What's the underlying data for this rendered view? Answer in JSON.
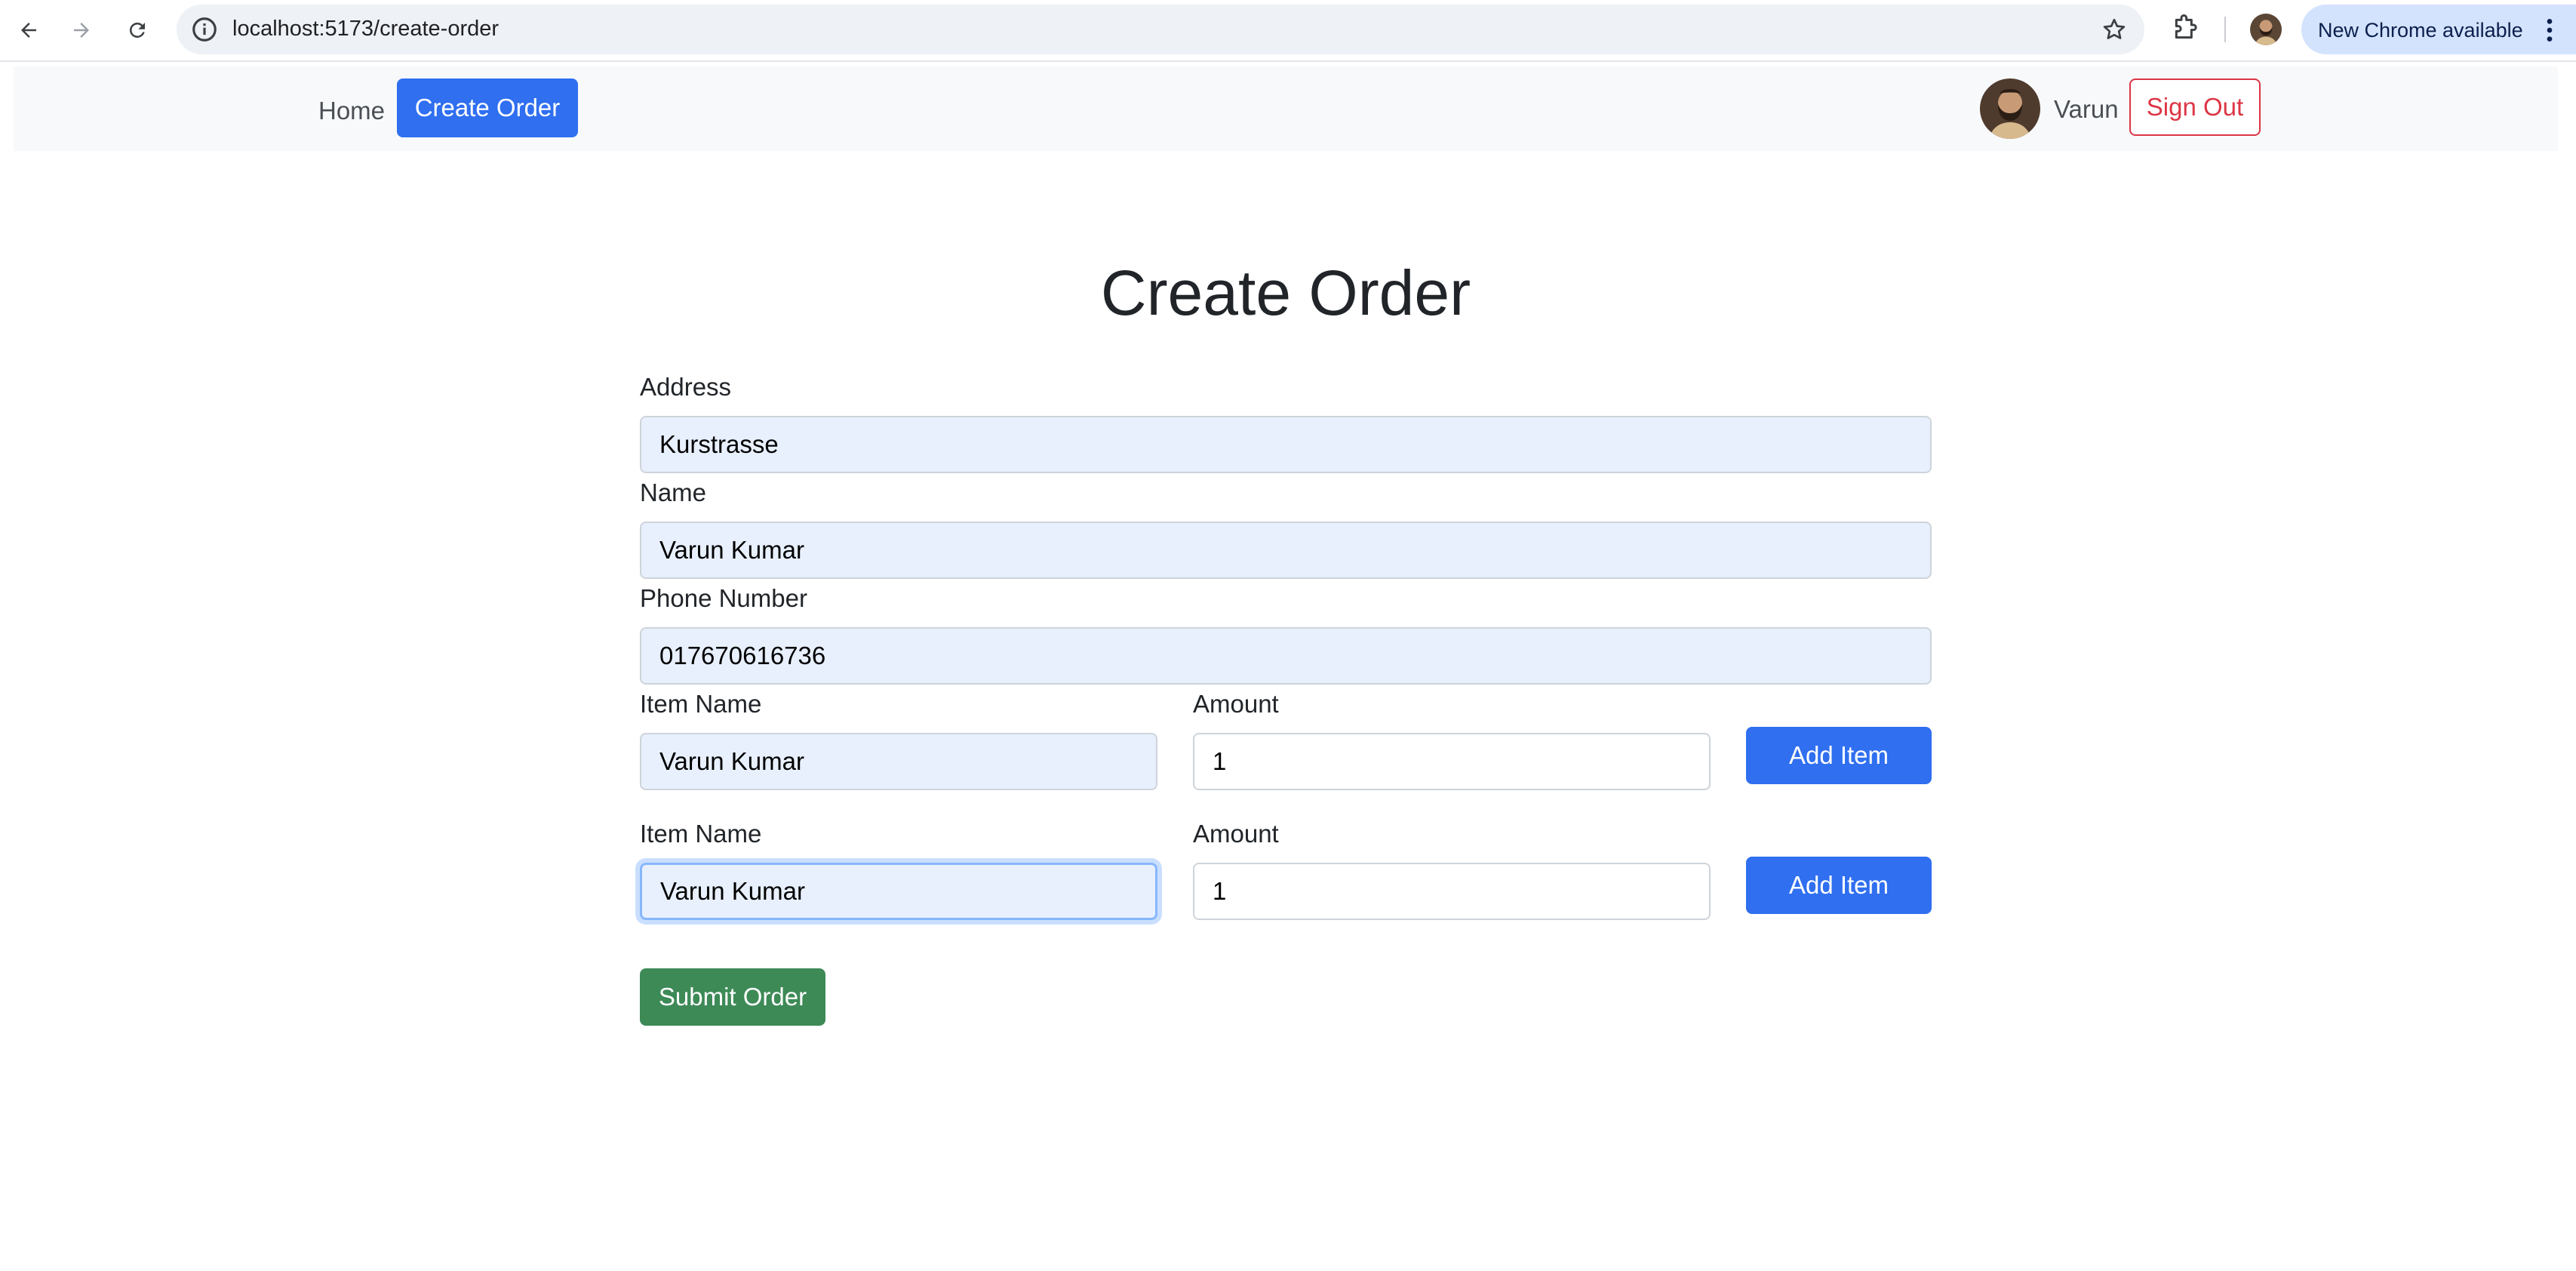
{
  "browser": {
    "url": "localhost:5173/create-order",
    "update_label": "New Chrome available"
  },
  "navbar": {
    "home_label": "Home",
    "create_order_label": "Create Order",
    "user_name": "Varun",
    "sign_out_label": "Sign Out"
  },
  "form": {
    "title": "Create Order",
    "address": {
      "label": "Address",
      "value": "Kurstrasse"
    },
    "name": {
      "label": "Name",
      "value": "Varun Kumar"
    },
    "phone": {
      "label": "Phone Number",
      "value": "017670616736"
    },
    "items": [
      {
        "item_label": "Item Name",
        "item_value": "Varun Kumar",
        "amount_label": "Amount",
        "amount_value": "1",
        "add_label": "Add Item"
      },
      {
        "item_label": "Item Name",
        "item_value": "Varun Kumar",
        "amount_label": "Amount",
        "amount_value": "1",
        "add_label": "Add Item"
      }
    ],
    "submit_label": "Submit Order"
  },
  "colors": {
    "primary": "#2f6ff0",
    "danger": "#dc3545",
    "success": "#3d8a57",
    "autofill_bg": "#e8f0fe"
  }
}
